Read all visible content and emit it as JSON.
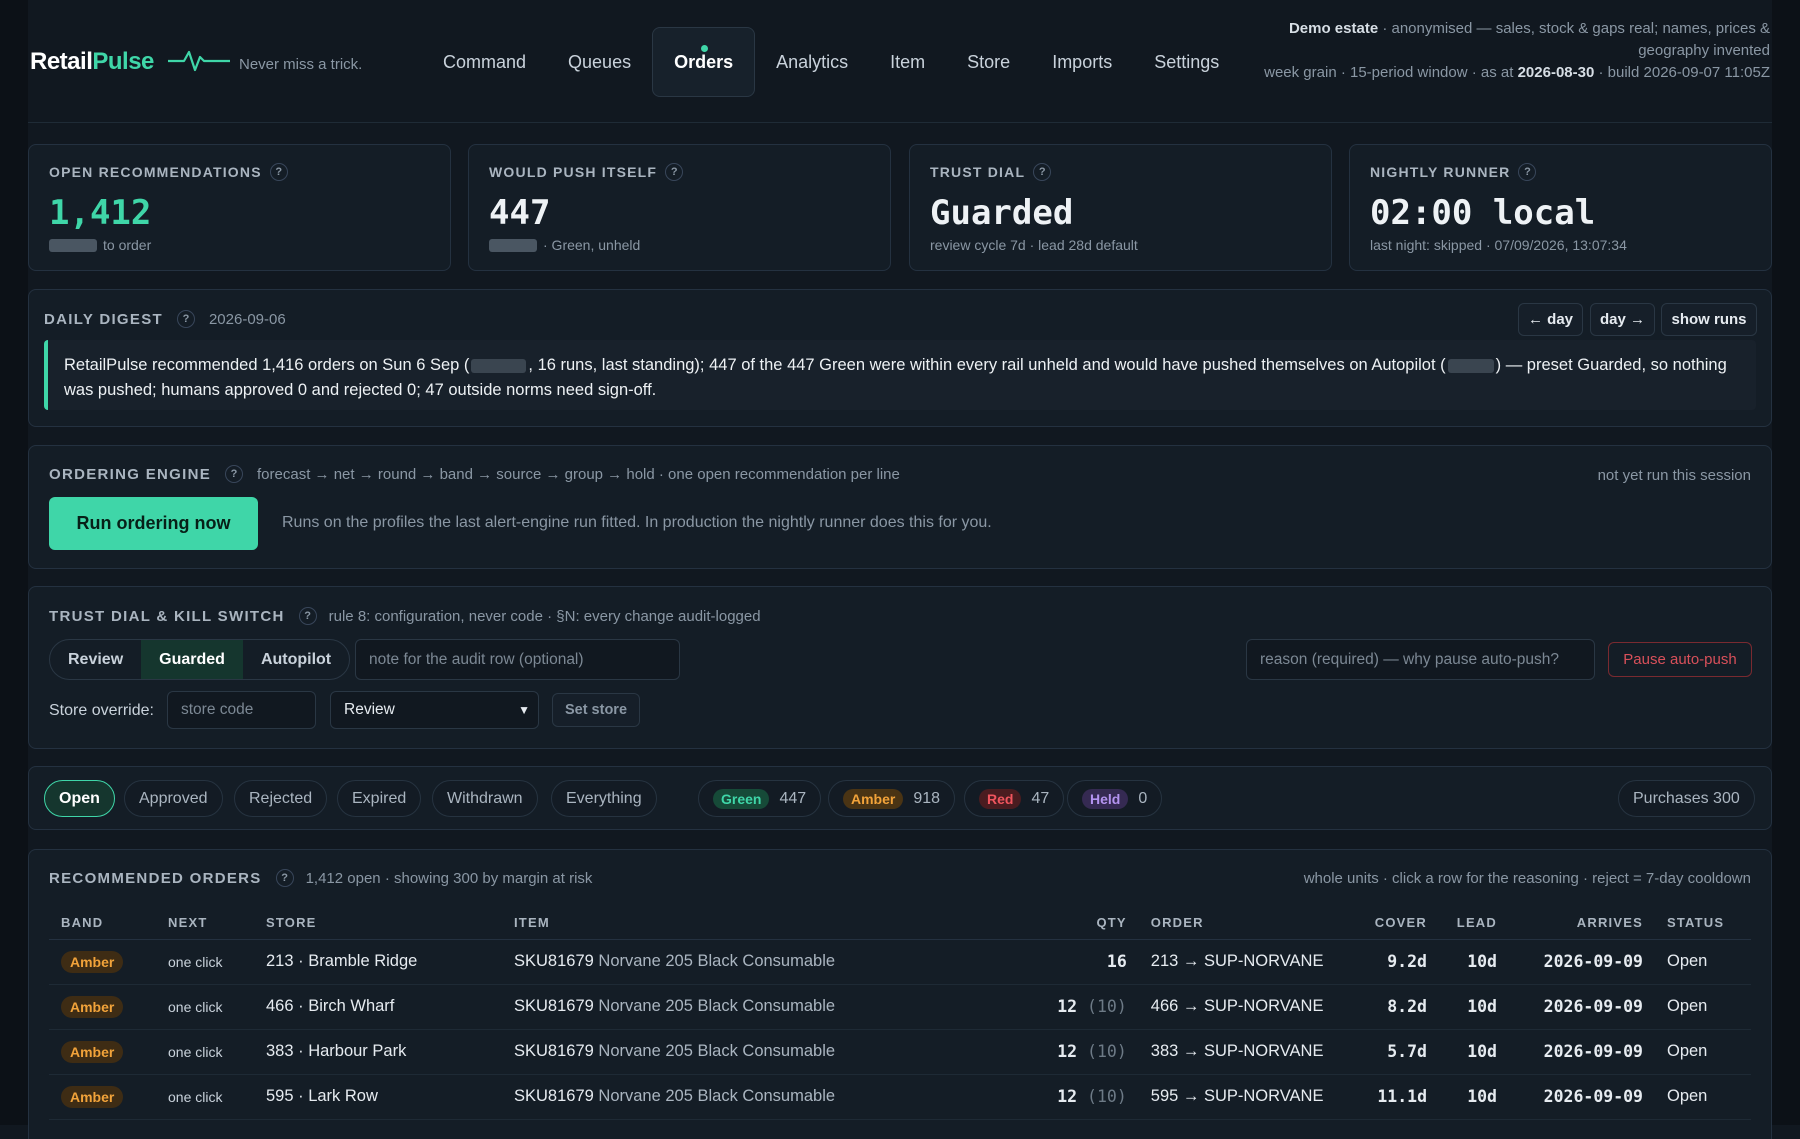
{
  "brand": {
    "name_a": "Retail",
    "name_b": "Pulse",
    "tagline": "Never miss a trick."
  },
  "nav": [
    {
      "label": "Command"
    },
    {
      "label": "Queues"
    },
    {
      "label": "Orders"
    },
    {
      "label": "Analytics"
    },
    {
      "label": "Item"
    },
    {
      "label": "Store"
    },
    {
      "label": "Imports"
    },
    {
      "label": "Settings"
    }
  ],
  "meta": {
    "estate": "Demo estate",
    "line1": " · anonymised — sales, stock & gaps real; names, prices & geography invented",
    "line2a": "week grain · 15-period window · as at ",
    "asat": "2026-08-30",
    "line2b": " · build 2026-09-07 11:05Z"
  },
  "kpis": [
    {
      "label": "OPEN RECOMMENDATIONS",
      "value": "1,412",
      "sub": "to order"
    },
    {
      "label": "WOULD PUSH ITSELF",
      "value": "447",
      "sub": "· Green, unheld"
    },
    {
      "label": "TRUST DIAL",
      "value": "Guarded",
      "sub": "review cycle 7d · lead 28d default"
    },
    {
      "label": "NIGHTLY RUNNER",
      "value": "02:00 local",
      "sub": "last night: skipped · 07/09/2026, 13:07:34"
    }
  ],
  "digest": {
    "title": "DAILY DIGEST",
    "date": "2026-09-06",
    "btn_prev": "← day",
    "btn_next": "day →",
    "btn_runs": "show runs",
    "text_a": "RetailPulse recommended 1,416 orders on Sun 6 Sep (",
    "text_b": ", 16 runs, last standing); 447 of the 447 Green were within every rail unheld and would have pushed themselves on Autopilot (",
    "text_c": ") — preset Guarded, so nothing was pushed; humans approved 0 and rejected 0; 47 outside norms need sign-off."
  },
  "engine": {
    "title": "ORDERING ENGINE",
    "pipeline": "forecast → net → round → band → source → group → hold · one open recommendation per line",
    "status": "not yet run this session",
    "run_label": "Run ordering now",
    "note": "Runs on the profiles the last alert-engine run fitted. In production the nightly runner does this for you."
  },
  "trust": {
    "title": "TRUST DIAL & KILL SWITCH",
    "rule": "rule 8: configuration, never code · §N: every change audit-logged",
    "modes": [
      "Review",
      "Guarded",
      "Autopilot"
    ],
    "note_placeholder": "note for the audit row (optional)",
    "reason_placeholder": "reason (required) — why pause auto-push?",
    "pause_label": "Pause auto-push",
    "override_label": "Store override:",
    "store_placeholder": "store code",
    "select_value": "Review",
    "set_store": "Set store"
  },
  "filters": {
    "status": [
      "Open",
      "Approved",
      "Rejected",
      "Expired",
      "Withdrawn",
      "Everything"
    ],
    "bands": [
      {
        "tag": "Green",
        "count": "447"
      },
      {
        "tag": "Amber",
        "count": "918"
      },
      {
        "tag": "Red",
        "count": "47"
      },
      {
        "tag": "Held",
        "count": "0"
      }
    ],
    "purchases": "Purchases 300"
  },
  "orders": {
    "title": "RECOMMENDED ORDERS",
    "summary": "1,412 open · showing 300 by margin at risk",
    "hint": "whole units · click a row for the reasoning · reject = 7-day cooldown",
    "columns": [
      "BAND",
      "NEXT",
      "STORE",
      "ITEM",
      "QTY",
      "ORDER",
      "COVER",
      "LEAD",
      "ARRIVES",
      "STATUS"
    ],
    "rows": [
      {
        "band": "Amber",
        "next": "one click",
        "store": "213 · Bramble Ridge",
        "sku": "SKU81679",
        "item": "Norvane 205 Black Consumable",
        "qty": "16",
        "qty_orig": "",
        "order": "213 → SUP-NORVANE",
        "cover": "9.2d",
        "lead": "10d",
        "arrives": "2026-09-09",
        "status": "Open"
      },
      {
        "band": "Amber",
        "next": "one click",
        "store": "466 · Birch Wharf",
        "sku": "SKU81679",
        "item": "Norvane 205 Black Consumable",
        "qty": "12",
        "qty_orig": "(10)",
        "order": "466 → SUP-NORVANE",
        "cover": "8.2d",
        "lead": "10d",
        "arrives": "2026-09-09",
        "status": "Open"
      },
      {
        "band": "Amber",
        "next": "one click",
        "store": "383 · Harbour Park",
        "sku": "SKU81679",
        "item": "Norvane 205 Black Consumable",
        "qty": "12",
        "qty_orig": "(10)",
        "order": "383 → SUP-NORVANE",
        "cover": "5.7d",
        "lead": "10d",
        "arrives": "2026-09-09",
        "status": "Open"
      },
      {
        "band": "Amber",
        "next": "one click",
        "store": "595 · Lark Row",
        "sku": "SKU81679",
        "item": "Norvane 205 Black Consumable",
        "qty": "12",
        "qty_orig": "(10)",
        "order": "595 → SUP-NORVANE",
        "cover": "11.1d",
        "lead": "10d",
        "arrives": "2026-09-09",
        "status": "Open"
      }
    ]
  }
}
